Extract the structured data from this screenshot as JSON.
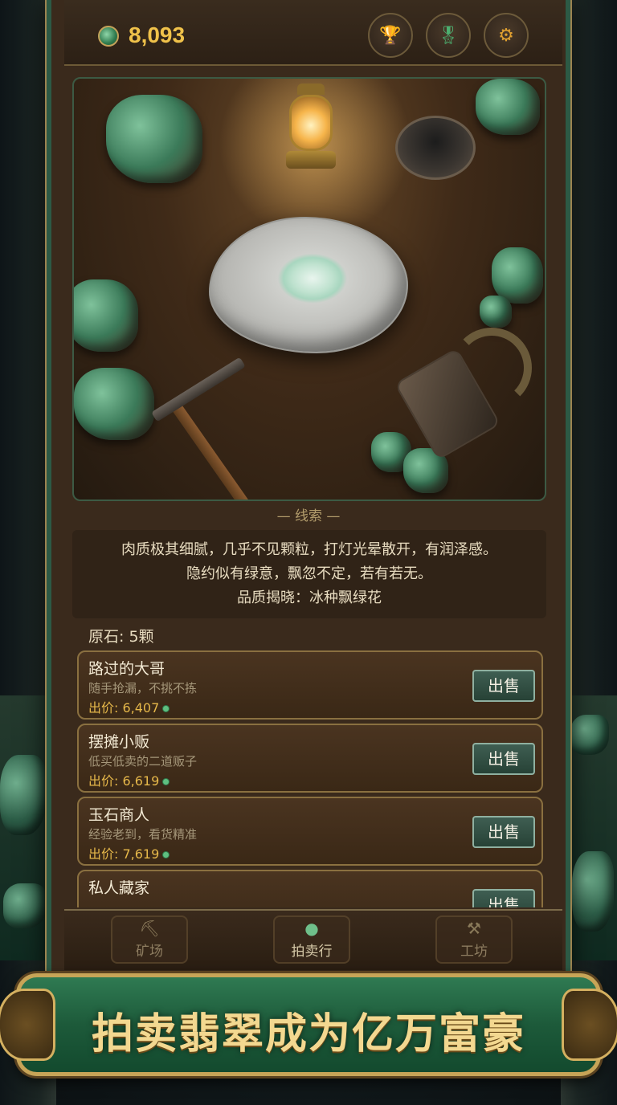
{
  "header": {
    "coin_value": "8,093",
    "icons": [
      "coin-icon",
      "trophy-icon",
      "medal-icon",
      "settings-gear-icon"
    ]
  },
  "scene": {
    "description_icons": [
      "lantern",
      "raw-jade-stone",
      "pickaxe",
      "bowl",
      "grinder"
    ]
  },
  "clue": {
    "title": "— 线索 —",
    "line1": "肉质极其细腻，几乎不见颗粒，打灯光晕散开，有润泽感。",
    "line2": "隐约似有绿意，飘忽不定，若有若无。",
    "line3": "品质揭晓：冰种飘绿花"
  },
  "stone_count": "原石: 5颗",
  "buyers": [
    {
      "name": "路过的大哥",
      "desc": "随手抢漏，不挑不拣",
      "price": "出价: 6,407",
      "sell_label": "出售"
    },
    {
      "name": "摆摊小贩",
      "desc": "低买低卖的二道贩子",
      "price": "出价: 6,619",
      "sell_label": "出售"
    },
    {
      "name": "玉石商人",
      "desc": "经验老到，看货精准",
      "price": "出价: 7,619",
      "sell_label": "出售"
    },
    {
      "name": "私人藏家",
      "desc": "",
      "price": "",
      "sell_label": "出售"
    }
  ],
  "nav": {
    "mine": "矿场",
    "auction": "拍卖行",
    "workshop": "工坊",
    "active": "auction"
  },
  "banner": {
    "text": "拍卖翡翠成为亿万富豪"
  },
  "colors": {
    "gold": "#f0c24a",
    "jade": "#2f7a52",
    "wood": "#3a2a1c"
  }
}
